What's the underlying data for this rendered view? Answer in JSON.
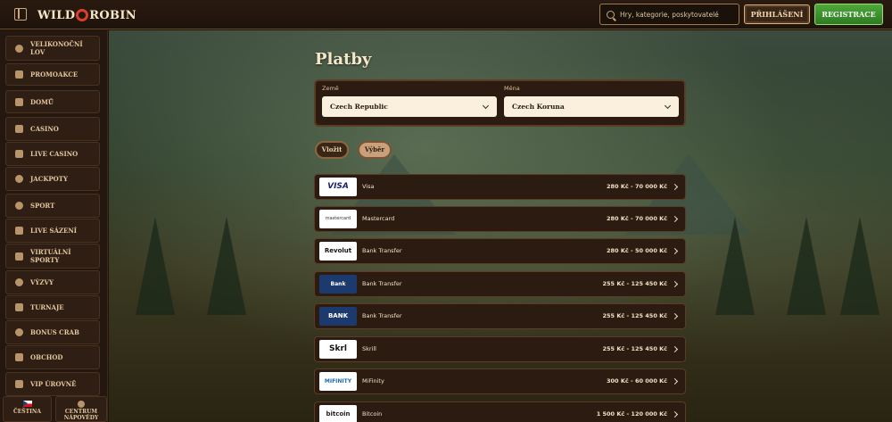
{
  "header": {
    "logo_left": "WILD",
    "logo_right": "ROBIN",
    "search_placeholder": "Hry, kategorie, poskytovatelé",
    "login_label": "PŘIHLÁŠENÍ",
    "register_label": "REGISTRACE"
  },
  "sidebar": {
    "items": [
      {
        "label": "VELIKONOČNÍ LOV",
        "icon": "egg-icon"
      },
      {
        "label": "PROMOAKCE",
        "icon": "gift-icon"
      },
      {
        "label": "DOMŮ",
        "icon": "home-icon"
      },
      {
        "label": "CASINO",
        "icon": "slot-icon"
      },
      {
        "label": "LIVE CASINO",
        "icon": "cards-icon"
      },
      {
        "label": "JACKPOTY",
        "icon": "clover-icon"
      },
      {
        "label": "SPORT",
        "icon": "ball-icon"
      },
      {
        "label": "LIVE SÁZENÍ",
        "icon": "live-icon"
      },
      {
        "label": "VIRTUÁLNÍ SPORTY",
        "icon": "virtual-icon"
      },
      {
        "label": "VÝZVY",
        "icon": "target-icon"
      },
      {
        "label": "TURNAJE",
        "icon": "trophy-icon"
      },
      {
        "label": "BONUS CRAB",
        "icon": "crab-icon"
      },
      {
        "label": "OBCHOD",
        "icon": "bag-icon"
      },
      {
        "label": "VIP ÚROVNĚ",
        "icon": "diamond-icon"
      }
    ],
    "language_label": "ČEŠTINA",
    "help_label": "CENTRUM NÁPOVĚDY"
  },
  "main": {
    "title": "Platby",
    "country_label": "Země",
    "country_value": "Czech Republic",
    "currency_label": "Měna",
    "currency_value": "Czech Koruna",
    "tabs": [
      {
        "label": "Vložit"
      },
      {
        "label": "Výběr"
      }
    ],
    "methods": [
      {
        "logo": "VISA",
        "name": "Visa",
        "range": "280 Kč - 70 000 Kč"
      },
      {
        "logo": "mastercard",
        "name": "Mastercard",
        "range": "280 Kč - 70 000 Kč"
      },
      {
        "logo": "Revolut",
        "name": "Bank Transfer",
        "range": "280 Kč - 50 000 Kč"
      },
      {
        "logo": "Bank",
        "name": "Bank Transfer",
        "range": "255 Kč - 125 450 Kč"
      },
      {
        "logo": "BANK",
        "name": "Bank Transfer",
        "range": "255 Kč - 125 450 Kč"
      },
      {
        "logo": "Skrl",
        "name": "Skrill",
        "range": "255 Kč - 125 450 Kč"
      },
      {
        "logo": "MIFINITY",
        "name": "MiFinity",
        "range": "300 Kč - 60 000 Kč"
      },
      {
        "logo": "bitcoin",
        "name": "Bitcoin",
        "range": "1 500 Kč - 120 000 Kč"
      }
    ]
  }
}
